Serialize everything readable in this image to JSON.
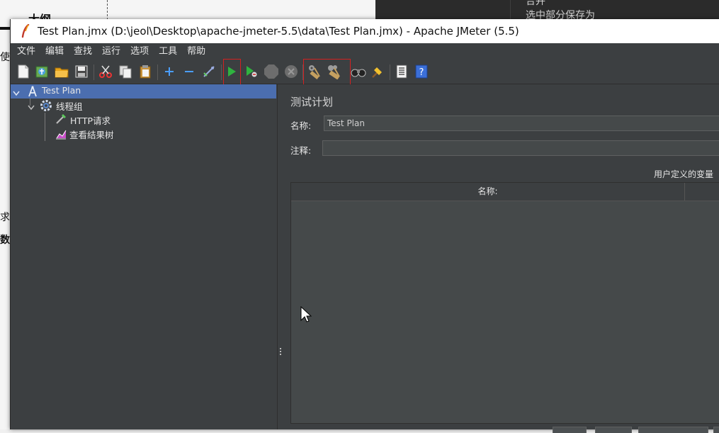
{
  "background": {
    "left_text_1": "大纲",
    "left_text_2": "使",
    "left_text_3": "求",
    "left_text_4": "数",
    "right_text_1": "合并",
    "right_text_2": "选中部分保存为"
  },
  "window": {
    "title": "Test Plan.jmx (D:\\jeol\\Desktop\\apache-jmeter-5.5\\data\\Test Plan.jmx) - Apache JMeter (5.5)"
  },
  "menu": {
    "items": [
      "文件",
      "编辑",
      "查找",
      "运行",
      "选项",
      "工具",
      "帮助"
    ]
  },
  "toolbar": {
    "icons": [
      "new-icon",
      "templates-icon",
      "open-icon",
      "save-icon",
      "cut-icon",
      "copy-icon",
      "paste-icon",
      "expand-icon",
      "collapse-icon",
      "toggle-icon",
      "start-icon",
      "start-no-pause-icon",
      "stop-icon",
      "shutdown-icon",
      "clear-icon",
      "clear-all-icon",
      "search-icon",
      "reset-search-icon",
      "function-helper-icon",
      "help-icon"
    ]
  },
  "tree": {
    "items": [
      {
        "label": "Test Plan",
        "icon": "test-plan-icon"
      },
      {
        "label": "线程组",
        "icon": "gear-icon"
      },
      {
        "label": "HTTP请求",
        "icon": "pipette-icon"
      },
      {
        "label": "查看结果树",
        "icon": "chart-icon"
      }
    ]
  },
  "panel": {
    "title": "测试计划",
    "name_label": "名称:",
    "name_value": "Test Plan",
    "comment_label": "注释:",
    "comment_value": "",
    "user_vars_label": "用户定义的变量",
    "table_header_name": "名称:"
  },
  "colors": {
    "dark_bg": "#3c3f41",
    "selection": "#4b6eaf",
    "highlight_box": "#d42020",
    "title_bar": "#ffffff"
  }
}
